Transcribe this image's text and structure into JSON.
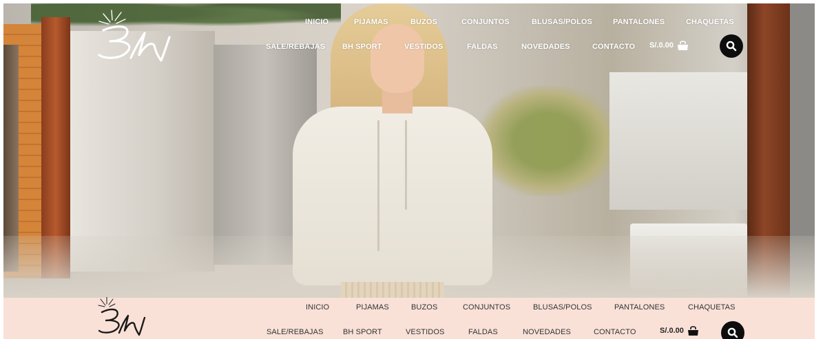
{
  "brand": {
    "logo_text": "BH"
  },
  "nav_row1": [
    "INICIO",
    "PIJAMAS",
    "BUZOS",
    "CONJUNTOS",
    "BLUSAS/POLOS",
    "PANTALONES",
    "CHAQUETAS"
  ],
  "nav_row2": [
    "SALE/REBAJAS",
    "BH SPORT",
    "VESTIDOS",
    "FALDAS",
    "NOVEDADES",
    "CONTACTO"
  ],
  "cart": {
    "total": "S/.0.00"
  },
  "icons": {
    "cart": "shopping-bag-icon",
    "search": "search-icon",
    "logo": "bh-crown-logo"
  },
  "colors": {
    "sticky_bar": "#f9e1d8",
    "search_button": "#0d0d0d",
    "nav_top_text": "#ffffff",
    "nav_bottom_text": "#333333"
  }
}
